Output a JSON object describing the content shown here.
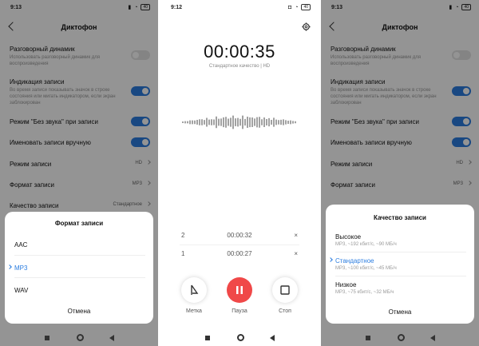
{
  "settings": {
    "time": "9:13",
    "battery": "40",
    "title": "Диктофон",
    "rows": [
      {
        "label": "Разговорный динамик",
        "sub": "Использовать разговорный динамик для воспроизведения",
        "toggle": "off"
      },
      {
        "label": "Индикация записи",
        "sub": "Во время записи показывать значок в строке состояния или мигать индикатором, если экран заблокирован",
        "toggle": "on"
      },
      {
        "label": "Режим \"Без звука\" при записи",
        "toggle": "on"
      },
      {
        "label": "Именовать записи вручную",
        "toggle": "on"
      },
      {
        "label": "Режим записи",
        "value": "HD"
      },
      {
        "label": "Формат записи",
        "value": "MP3"
      },
      {
        "label": "Качество записи",
        "value": "Стандартное"
      }
    ]
  },
  "format_sheet": {
    "title": "Формат записи",
    "options": [
      "AAC",
      "MP3",
      "WAV"
    ],
    "selected": "MP3",
    "cancel": "Отмена"
  },
  "recorder": {
    "time": "9:12",
    "battery": "40",
    "elapsed": "00:00:35",
    "quality": "Стандартное качество | HD",
    "marks": [
      {
        "n": "2",
        "time": "00:00:32"
      },
      {
        "n": "1",
        "time": "00:00:27"
      }
    ],
    "mark_glyph": "×",
    "buttons": {
      "mark": "Метка",
      "pause": "Пауза",
      "stop": "Стоп"
    }
  },
  "quality_sheet": {
    "title": "Качество записи",
    "options": [
      {
        "label": "Высокое",
        "sub": "MP3, ~192 кбит/с, ~90 МБ/ч"
      },
      {
        "label": "Стандартное",
        "sub": "MP3, ~100 кбит/с, ~45 МБ/ч"
      },
      {
        "label": "Низкое",
        "sub": "MP3, ~75 кбит/с, ~32 МБ/ч"
      }
    ],
    "selected": "Стандартное",
    "cancel": "Отмена"
  },
  "colors": {
    "accent": "#2b7de0",
    "record": "#f04848"
  }
}
